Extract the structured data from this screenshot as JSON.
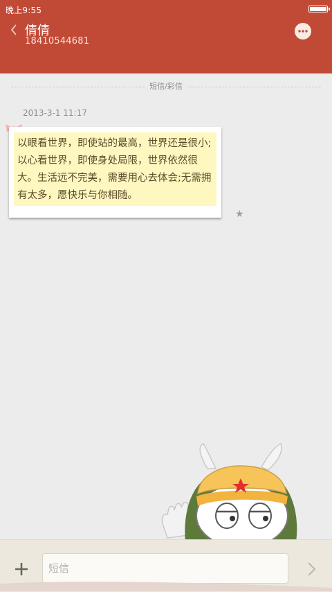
{
  "status_bar": {
    "time": "晚上9:55",
    "battery_level": 1.0
  },
  "header": {
    "back_icon": "chevron-left-icon",
    "contact_name": "倩倩",
    "phone_number": "18410544681",
    "more_icon": "more-dots-icon"
  },
  "conversation": {
    "divider_label": "短信/彩信",
    "messages": [
      {
        "timestamp": "2013-3-1 11:17",
        "text": "以眼看世界，即使站的最高，世界还是很小;以心看世界，即使身处局限，世界依然很大。生活远不完美，需要用心去体会;无需拥有太多，愿快乐与你相随。",
        "starred": true
      }
    ]
  },
  "composer": {
    "placeholder": "短信",
    "value": "",
    "add_icon": "plus-icon",
    "send_icon": "chevron-right-icon"
  },
  "colors": {
    "accent": "#c04a36",
    "note_bg": "#fff7c0",
    "page_bg": "#ececec",
    "bottom_bar": "#ede8de"
  }
}
